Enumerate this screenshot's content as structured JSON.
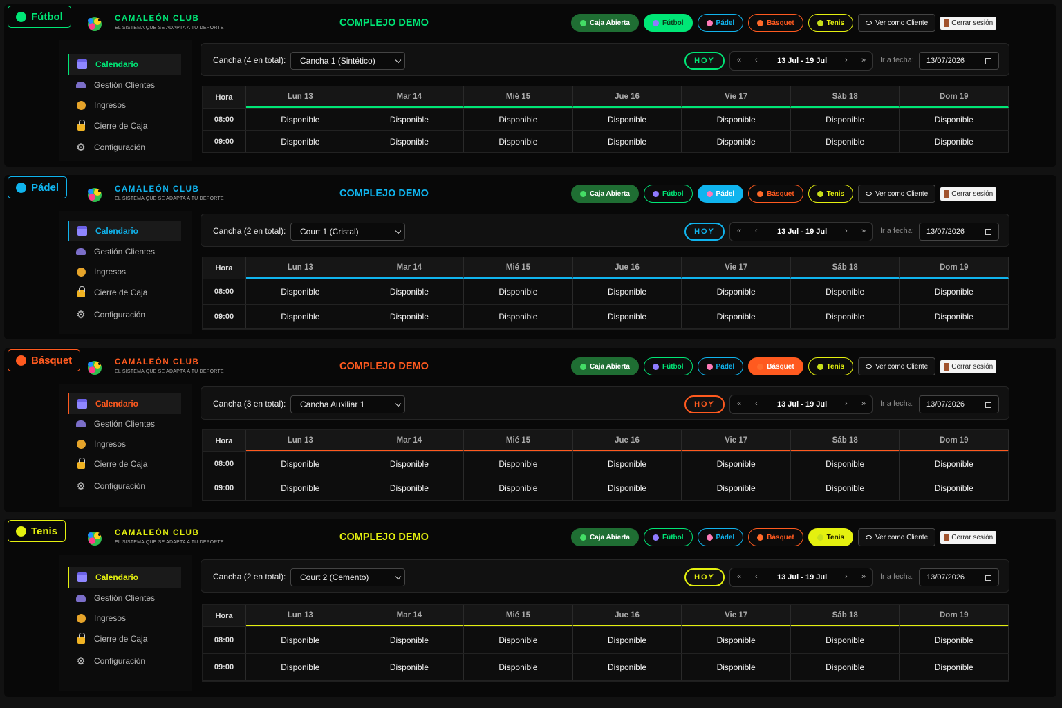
{
  "brand": {
    "title": "CAMALEÓN CLUB",
    "subtitle": "EL SISTEMA QUE SE ADAPTA A TU DEPORTE"
  },
  "complex": "COMPLEJO DEMO",
  "nav": {
    "caja": "Caja Abierta",
    "futbol": "Fútbol",
    "padel": "Pádel",
    "basquet": "Básquet",
    "tenis": "Tenis",
    "ver_cliente": "Ver como Cliente",
    "logout": "Cerrar sesión"
  },
  "sidebar": {
    "items": [
      {
        "label": "Calendario",
        "icon": "calendar-icon"
      },
      {
        "label": "Gestión Clientes",
        "icon": "users-icon"
      },
      {
        "label": "Ingresos",
        "icon": "money-bag-icon"
      },
      {
        "label": "Cierre de Caja",
        "icon": "lock-icon"
      },
      {
        "label": "Configuración",
        "icon": "gear-icon"
      }
    ]
  },
  "toolbar": {
    "hoy": "HOY",
    "week": "13 Jul - 19 Jul",
    "first": "«",
    "prev": "‹",
    "next": "›",
    "last": "»",
    "goto_label": "Ir a fecha:",
    "date_value": "13/07/2026"
  },
  "grid": {
    "hour_header": "Hora",
    "days": [
      "Lun 13",
      "Mar 14",
      "Mié 15",
      "Jue 16",
      "Vie 17",
      "Sáb 18",
      "Dom 19"
    ],
    "hours": [
      "08:00",
      "09:00"
    ],
    "cell": "Disponible"
  },
  "panels": [
    {
      "sport": "Fútbol",
      "color": "#00e676",
      "court_label": "Cancha (4 en total):",
      "court_value": "Cancha 1 (Sintético)",
      "active": "futbol"
    },
    {
      "sport": "Pádel",
      "color": "#10b4ee",
      "court_label": "Cancha (2 en total):",
      "court_value": "Court 1 (Cristal)",
      "active": "padel"
    },
    {
      "sport": "Básquet",
      "color": "#ff5a1f",
      "court_label": "Cancha (3 en total):",
      "court_value": "Cancha Auxiliar 1",
      "active": "basquet"
    },
    {
      "sport": "Tenis",
      "color": "#e4f00f",
      "court_label": "Cancha (2 en total):",
      "court_value": "Court 2 (Cemento)",
      "active": "tenis"
    }
  ],
  "colors": {
    "futbol": "#00e676",
    "padel": "#10b4ee",
    "basquet": "#ff5a1f",
    "tenis": "#e4f00f",
    "caja": "#1f6e33"
  }
}
